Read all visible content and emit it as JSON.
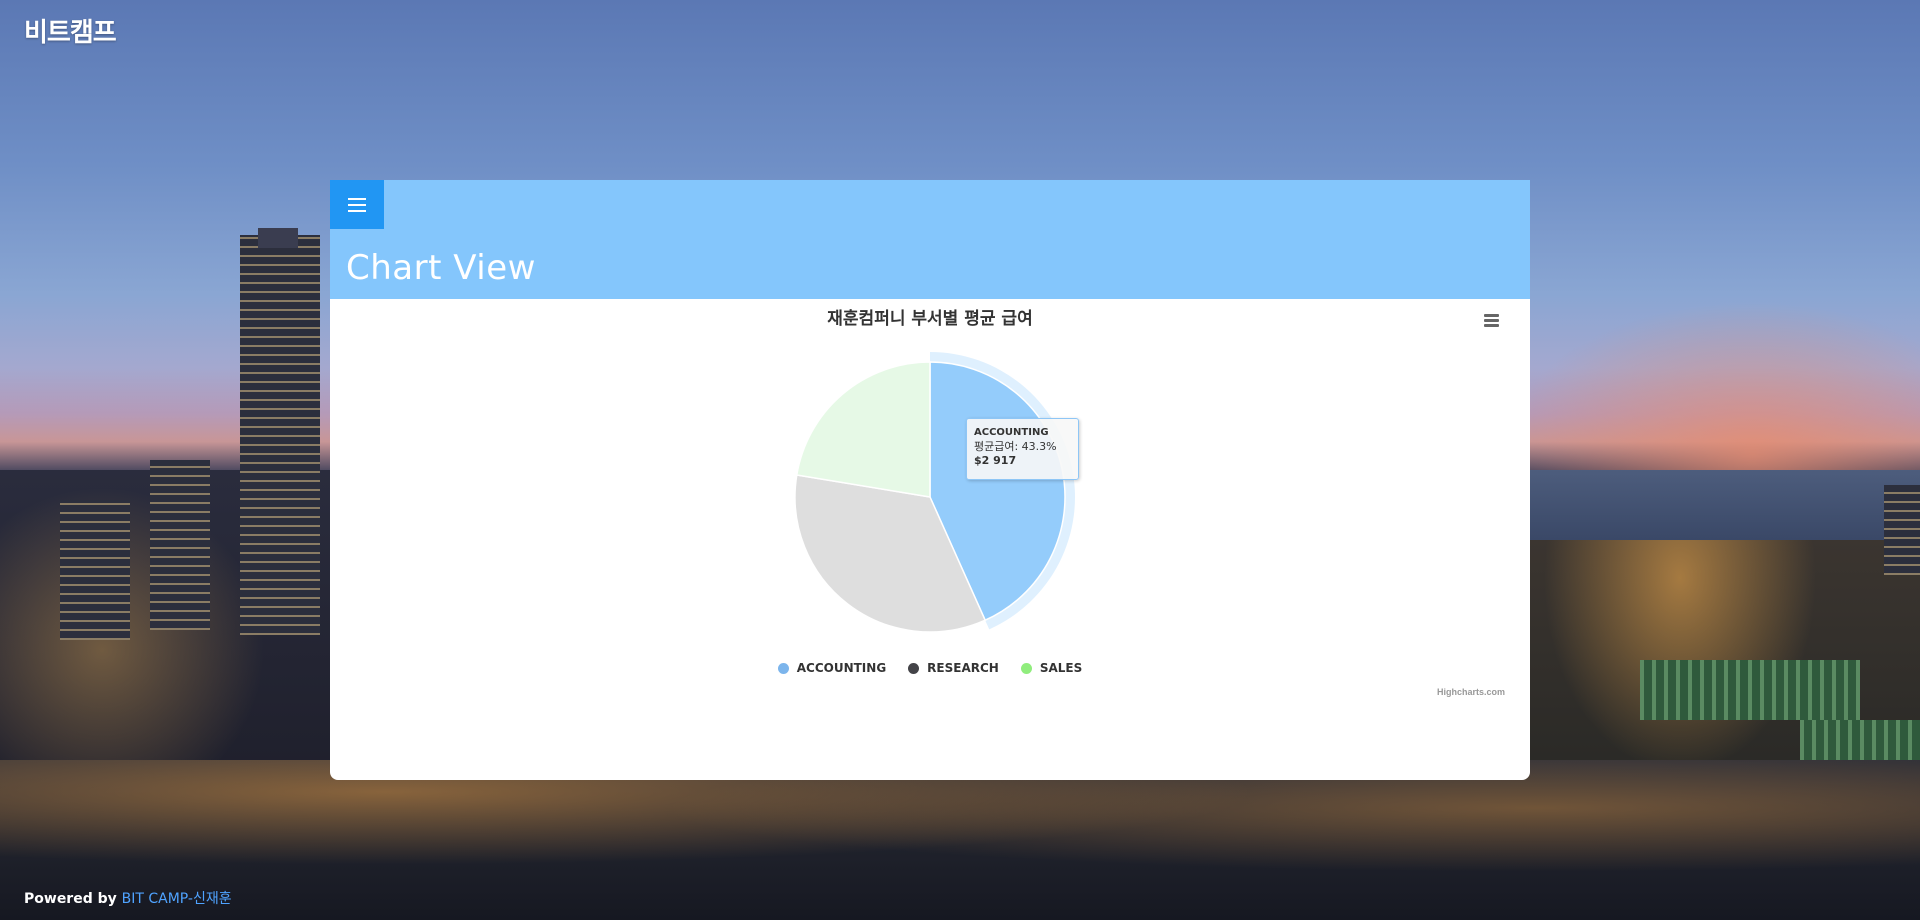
{
  "brand": {
    "title": "비트캠프"
  },
  "header": {
    "menu_icon": "hamburger-icon",
    "page_title": "Chart View"
  },
  "colors": {
    "header_bg": "#84c6fc",
    "menu_button": "#2196f3"
  },
  "chart": {
    "export_icon": "hamburger-menu-icon",
    "credits": "Highcharts.com",
    "tooltip": {
      "name": "ACCOUNTING",
      "label": "평균급여: 43.3%",
      "value": "$2 917"
    }
  },
  "chart_data": {
    "type": "pie",
    "title": "재훈컴퍼니 부서별 평균 급여",
    "categories": [
      "ACCOUNTING",
      "RESEARCH",
      "SALES"
    ],
    "values": [
      43.3,
      34.3,
      22.4
    ],
    "units": "%",
    "colors": [
      "#94ccfb",
      "#dedede",
      "#e6f9e6"
    ],
    "legend_colors": [
      "#7cb5ec",
      "#434348",
      "#90ed7d"
    ],
    "highlighted": "ACCOUNTING",
    "legend_position": "bottom-center"
  },
  "footer": {
    "powered_by": "Powered by ",
    "link_text": "BIT CAMP-신재훈"
  }
}
